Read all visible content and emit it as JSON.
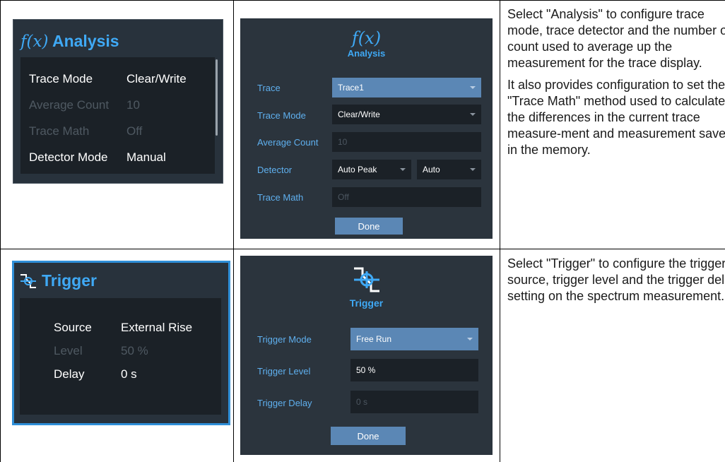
{
  "analysis_widget": {
    "fx_symbol": "f(x)",
    "title": "Analysis",
    "rows": [
      {
        "label": "Trace Mode",
        "value": "Clear/Write",
        "enabled": true
      },
      {
        "label": "Average Count",
        "value": "10",
        "enabled": false
      },
      {
        "label": "Trace Math",
        "value": "Off",
        "enabled": false
      },
      {
        "label": "Detector Mode",
        "value": "Manual",
        "enabled": true
      }
    ]
  },
  "analysis_dialog": {
    "fx_symbol": "f(x)",
    "title": "Analysis",
    "trace_label": "Trace",
    "trace_value": "Trace1",
    "trace_mode_label": "Trace Mode",
    "trace_mode_value": "Clear/Write",
    "average_count_label": "Average Count",
    "average_count_value": "10",
    "detector_label": "Detector",
    "detector_value": "Auto Peak",
    "detector_mode_value": "Auto",
    "trace_math_label": "Trace Math",
    "trace_math_value": "Off",
    "done_label": "Done"
  },
  "analysis_description": [
    "Select \"Analysis\" to configure trace mode, trace detector and the number of count used to average up the measurement for the trace display.",
    "It also provides configuration to set the \"Trace Math\" method used to calculate the differences in the current trace measure-ment and measurement saved in the memory."
  ],
  "trigger_widget": {
    "title": "Trigger",
    "rows": [
      {
        "label": "Source",
        "value": "External Rise",
        "enabled": true
      },
      {
        "label": "Level",
        "value": "50 %",
        "enabled": false
      },
      {
        "label": "Delay",
        "value": "0 s",
        "enabled": true
      }
    ]
  },
  "trigger_dialog": {
    "title": "Trigger",
    "trigger_mode_label": "Trigger Mode",
    "trigger_mode_value": "Free Run",
    "trigger_level_label": "Trigger Level",
    "trigger_level_value": "50 %",
    "trigger_delay_label": "Trigger Delay",
    "trigger_delay_value": "0 s",
    "done_label": "Done"
  },
  "trigger_description": [
    "Select \"Trigger\" to configure the trigger source, trigger level and the trigger delay setting on the spectrum measurement."
  ],
  "colors": {
    "accent": "#3fa9f5",
    "widget_bg": "#28323c",
    "panel_bg": "#1b2127",
    "selected_field": "#5b87b5"
  }
}
